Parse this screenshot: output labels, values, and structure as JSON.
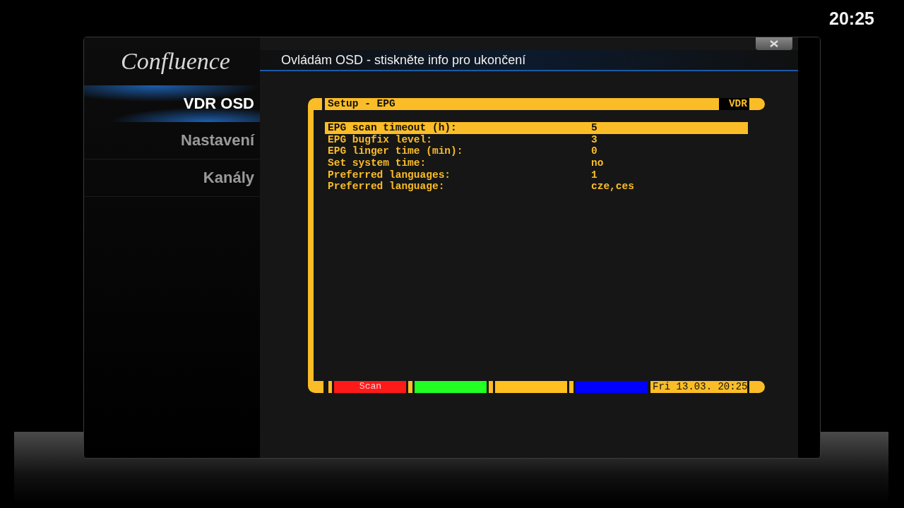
{
  "clock": "20:25",
  "logo": "Confluence",
  "sidebar": {
    "items": [
      {
        "label": "VDR OSD",
        "selected": true
      },
      {
        "label": "Nastavení",
        "selected": false
      },
      {
        "label": "Kanály",
        "selected": false
      }
    ]
  },
  "header": {
    "title": "Ovládám OSD - stiskněte info pro ukončení"
  },
  "osd": {
    "title": "Setup - EPG",
    "badge": "VDR",
    "rows": [
      {
        "label": "EPG scan timeout (h):",
        "value": "5",
        "selected": true
      },
      {
        "label": "EPG bugfix level:",
        "value": "3",
        "selected": false
      },
      {
        "label": "EPG linger time (min):",
        "value": "0",
        "selected": false
      },
      {
        "label": "Set system time:",
        "value": "no",
        "selected": false
      },
      {
        "label": "Preferred languages:",
        "value": "1",
        "selected": false
      },
      {
        "label": "Preferred language:",
        "value": "cze,ces",
        "selected": false
      }
    ],
    "color_buttons": [
      {
        "label": "Scan",
        "color": "#ff1a1a"
      },
      {
        "color": "#22ff22"
      },
      {
        "color": "#ffc020"
      },
      {
        "color": "#0000ff"
      }
    ],
    "datetime": "Fri 13.03. 20:25"
  }
}
